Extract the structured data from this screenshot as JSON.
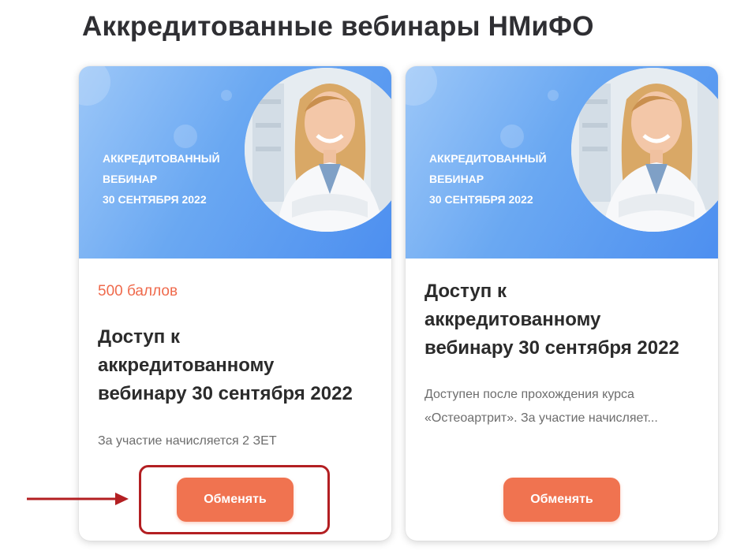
{
  "page": {
    "title": "Аккредитованные вебинары НМиФО"
  },
  "colors": {
    "accent": "#f07350",
    "points": "#ef6a4c",
    "banner": "#5a9af0",
    "annotation": "#b31f22"
  },
  "cards": [
    {
      "banner_lines": [
        "Аккредитованный",
        "вебинар",
        "30 сентября 2022"
      ],
      "points": "500 баллов",
      "title_lines": [
        "Доступ к",
        "аккредитованному",
        "вебинару 30 сентября 2022"
      ],
      "description_lines": [
        "За участие начисляется 2 ЗЕТ"
      ],
      "button_label": "Обменять"
    },
    {
      "banner_lines": [
        "Аккредитованный",
        "вебинар",
        "30 сентября 2022"
      ],
      "title_lines": [
        "Доступ к",
        "аккредитованному",
        "вебинару 30 сентября 2022"
      ],
      "description_lines": [
        "Доступен после прохождения курса",
        "«Остеоартрит». За участие начисляет..."
      ],
      "button_label": "Обменять"
    }
  ],
  "annotation": {
    "arrow_icon": "arrow-right-icon",
    "highlight": "exchange-button-highlight"
  }
}
